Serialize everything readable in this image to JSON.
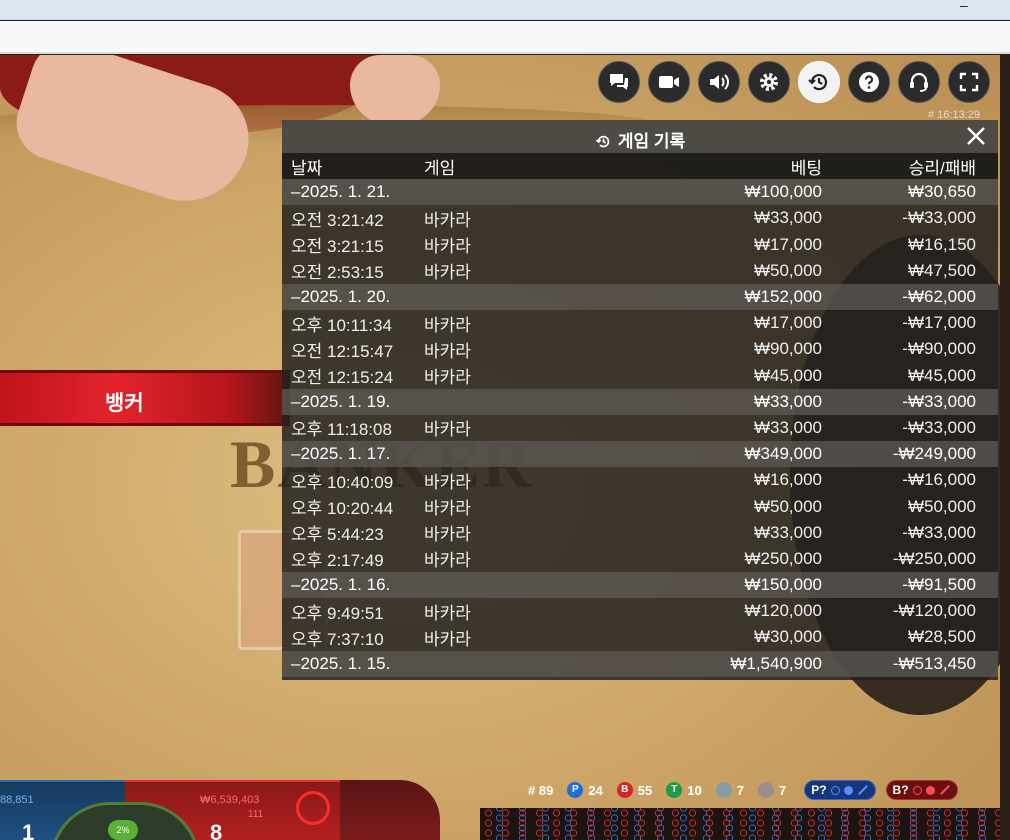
{
  "chrome": {
    "minimize_glyph": "–"
  },
  "scene": {
    "banner": "뱅커",
    "felt_text": "BANKER"
  },
  "toolbar": {
    "buttons": [
      {
        "name": "chat-icon"
      },
      {
        "name": "video-icon"
      },
      {
        "name": "sound-icon"
      },
      {
        "name": "settings-icon"
      },
      {
        "name": "history-icon",
        "active": true
      },
      {
        "name": "help-icon"
      },
      {
        "name": "support-icon"
      },
      {
        "name": "fullscreen-icon"
      }
    ],
    "clock": "# 16:13:29"
  },
  "history": {
    "title": "게임 기록",
    "columns": {
      "date": "날짜",
      "game": "게임",
      "bet": "베팅",
      "result": "승리/패배"
    },
    "rows": [
      {
        "type": "day",
        "date": "–2025. 1. 21.",
        "game": "",
        "bet": "₩100,000",
        "result": "₩30,650"
      },
      {
        "type": "item",
        "date": "오전 3:21:42",
        "game": "바카라",
        "bet": "₩33,000",
        "result": "-₩33,000"
      },
      {
        "type": "item",
        "date": "오전 3:21:15",
        "game": "바카라",
        "bet": "₩17,000",
        "result": "₩16,150"
      },
      {
        "type": "item",
        "date": "오전 2:53:15",
        "game": "바카라",
        "bet": "₩50,000",
        "result": "₩47,500"
      },
      {
        "type": "day",
        "date": "–2025. 1. 20.",
        "game": "",
        "bet": "₩152,000",
        "result": "-₩62,000"
      },
      {
        "type": "item",
        "date": "오후 10:11:34",
        "game": "바카라",
        "bet": "₩17,000",
        "result": "-₩17,000"
      },
      {
        "type": "item",
        "date": "오전 12:15:47",
        "game": "바카라",
        "bet": "₩90,000",
        "result": "-₩90,000"
      },
      {
        "type": "item",
        "date": "오전 12:15:24",
        "game": "바카라",
        "bet": "₩45,000",
        "result": "₩45,000"
      },
      {
        "type": "day",
        "date": "–2025. 1. 19.",
        "game": "",
        "bet": "₩33,000",
        "result": "-₩33,000"
      },
      {
        "type": "item",
        "date": "오후 11:18:08",
        "game": "바카라",
        "bet": "₩33,000",
        "result": "-₩33,000"
      },
      {
        "type": "day",
        "date": "–2025. 1. 17.",
        "game": "",
        "bet": "₩349,000",
        "result": "-₩249,000"
      },
      {
        "type": "item",
        "date": "오후 10:40:09",
        "game": "바카라",
        "bet": "₩16,000",
        "result": "-₩16,000"
      },
      {
        "type": "item",
        "date": "오후 10:20:44",
        "game": "바카라",
        "bet": "₩50,000",
        "result": "₩50,000"
      },
      {
        "type": "item",
        "date": "오후 5:44:23",
        "game": "바카라",
        "bet": "₩33,000",
        "result": "-₩33,000"
      },
      {
        "type": "item",
        "date": "오후 2:17:49",
        "game": "바카라",
        "bet": "₩250,000",
        "result": "-₩250,000"
      },
      {
        "type": "day",
        "date": "–2025. 1. 16.",
        "game": "",
        "bet": "₩150,000",
        "result": "-₩91,500"
      },
      {
        "type": "item",
        "date": "오후 9:49:51",
        "game": "바카라",
        "bet": "₩120,000",
        "result": "-₩120,000"
      },
      {
        "type": "item",
        "date": "오후 7:37:10",
        "game": "바카라",
        "bet": "₩30,000",
        "result": "₩28,500"
      },
      {
        "type": "day",
        "date": "–2025. 1. 15.",
        "game": "",
        "bet": "₩1,540,900",
        "result": "-₩513,450"
      }
    ]
  },
  "bottom": {
    "player_amount": "88,851",
    "banker_amount": "₩6,539,403",
    "banker_sub": "111",
    "percent": "2%",
    "player_score": "1",
    "banker_score": "8"
  },
  "stats": {
    "rounds": "# 89",
    "player_letter": "P",
    "player": "24",
    "banker_letter": "B",
    "banker": "55",
    "tie_letter": "T",
    "tie": "10",
    "player_pair": "7",
    "banker_pair": "7",
    "player_predict": "P?",
    "banker_predict": "B?"
  },
  "colors": {
    "player": "#1f6fd6",
    "banker": "#d72424",
    "tie": "#1c9b4b",
    "panel": "#24221e"
  }
}
